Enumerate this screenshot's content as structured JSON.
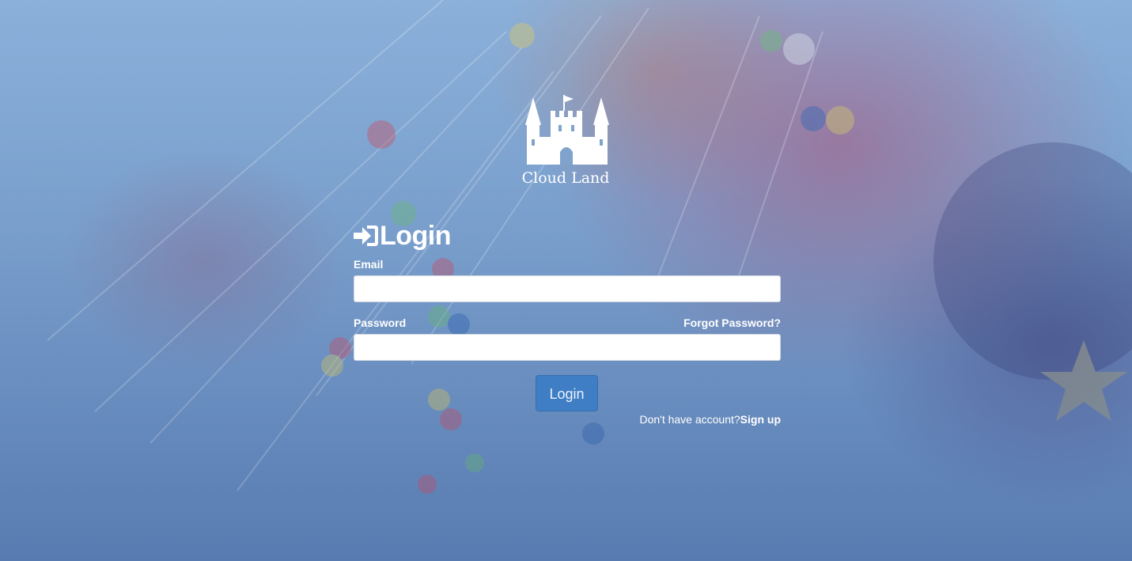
{
  "brand": {
    "name": "Cloud Land",
    "logo_icon": "castle-icon"
  },
  "login": {
    "heading": "Login",
    "heading_icon": "sign-in-icon",
    "email_label": "Email",
    "email_value": "",
    "email_placeholder": "",
    "password_label": "Password",
    "password_value": "",
    "password_placeholder": "",
    "forgot_password": "Forgot Password?",
    "submit_label": "Login",
    "signup_prompt": "Don't have account?",
    "signup_link": "Sign up"
  },
  "colors": {
    "button": "#3f7ec4",
    "text": "#ffffff"
  }
}
